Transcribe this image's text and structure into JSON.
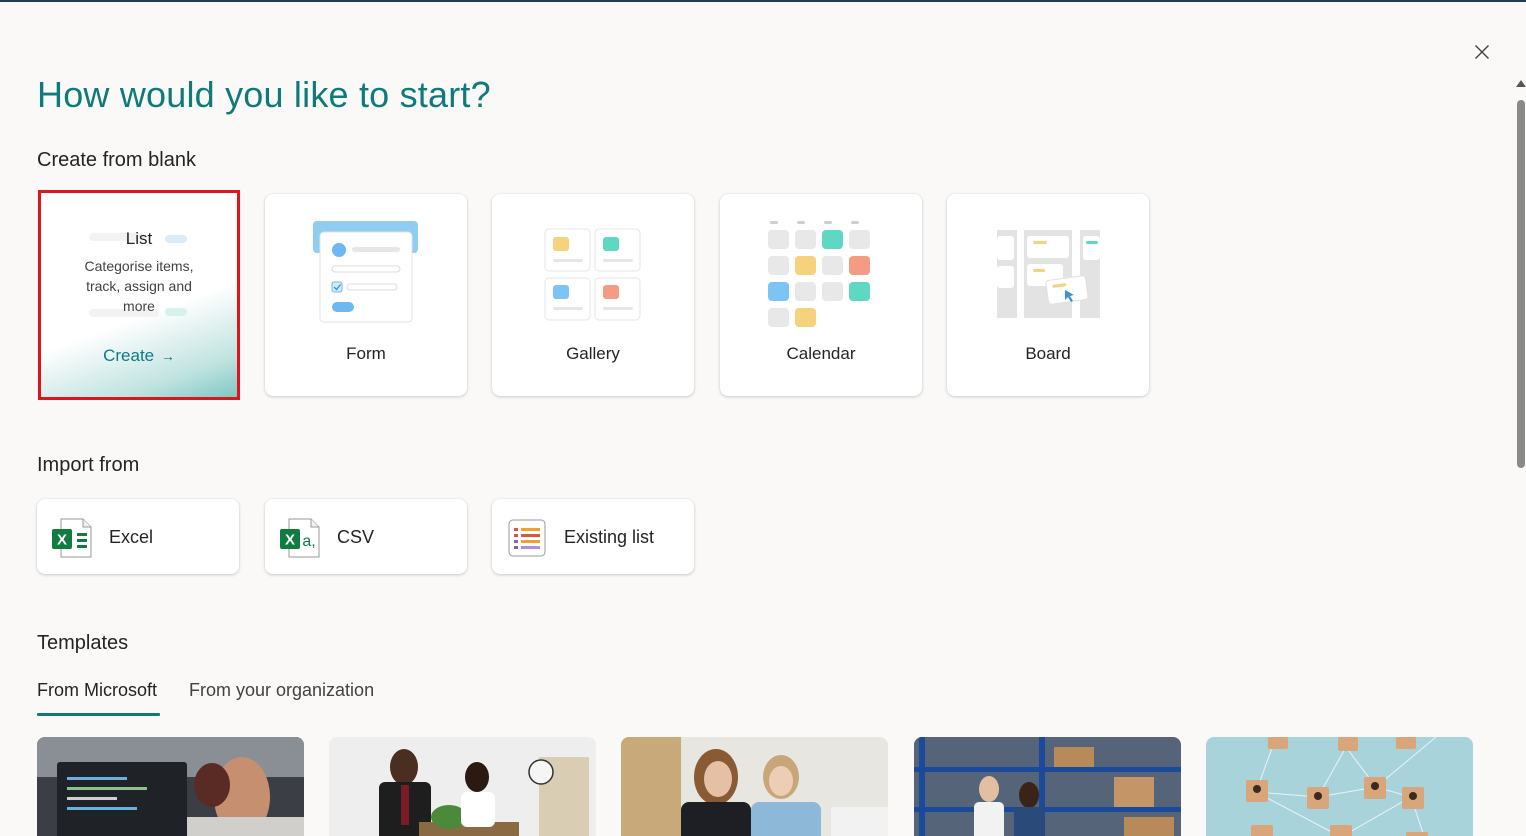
{
  "header": {
    "title": "How would you like to start?",
    "close_icon": "close-icon"
  },
  "create_from_blank": {
    "heading": "Create from blank",
    "list_card": {
      "title": "List",
      "description": "Categorise items, track, assign and more",
      "action": "Create",
      "arrow": "→"
    },
    "cards": [
      {
        "label": "Form",
        "icon": "form-illustration"
      },
      {
        "label": "Gallery",
        "icon": "gallery-illustration"
      },
      {
        "label": "Calendar",
        "icon": "calendar-illustration"
      },
      {
        "label": "Board",
        "icon": "board-illustration"
      }
    ]
  },
  "import_from": {
    "heading": "Import from",
    "items": [
      {
        "label": "Excel",
        "icon": "excel-icon"
      },
      {
        "label": "CSV",
        "icon": "csv-icon"
      },
      {
        "label": "Existing list",
        "icon": "existing-list-icon"
      }
    ]
  },
  "templates": {
    "heading": "Templates",
    "tabs": [
      {
        "label": "From Microsoft",
        "active": true
      },
      {
        "label": "From your organization",
        "active": false
      }
    ]
  },
  "colors": {
    "accent": "#0e7a7a",
    "selection_outline": "#e0151b",
    "excel_green": "#107c41"
  }
}
